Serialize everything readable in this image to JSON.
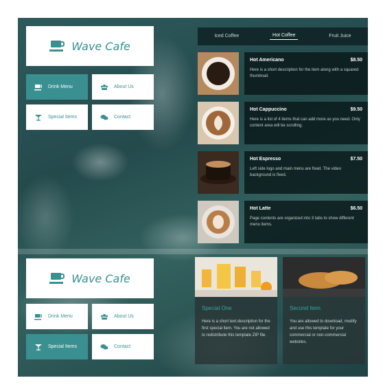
{
  "brand": {
    "name": "Wave Cafe",
    "accent": "#3a9090"
  },
  "nav_top": {
    "items": [
      {
        "label": "Drink Menu",
        "icon": "coffee-icon",
        "active": true
      },
      {
        "label": "About Us",
        "icon": "users-icon",
        "active": false
      },
      {
        "label": "Special Items",
        "icon": "cocktail-icon",
        "active": false
      },
      {
        "label": "Contact",
        "icon": "chat-icon",
        "active": false
      }
    ]
  },
  "nav_bottom": {
    "items": [
      {
        "label": "Drink Menu",
        "icon": "coffee-icon",
        "active": false
      },
      {
        "label": "About Us",
        "icon": "users-icon",
        "active": false
      },
      {
        "label": "Special Items",
        "icon": "cocktail-icon",
        "active": true
      },
      {
        "label": "Contact",
        "icon": "chat-icon",
        "active": false
      }
    ]
  },
  "tabs": [
    {
      "label": "Iced Coffee",
      "active": false
    },
    {
      "label": "Hot Coffee",
      "active": true
    },
    {
      "label": "Fruit Juice",
      "active": false
    }
  ],
  "menu_items": [
    {
      "name": "Hot Americano",
      "price": "$8.50",
      "desc": "Here is a short description for the item along with a squared thumbnail."
    },
    {
      "name": "Hot Cappuccino",
      "price": "$9.50",
      "desc": "Here is a list of 4 items that can add more as you need. Only content area will be scrolling."
    },
    {
      "name": "Hot Espresso",
      "price": "$7.50",
      "desc": "Left side logo and main menu are fixed. The video background is fixed."
    },
    {
      "name": "Hot Latte",
      "price": "$6.50",
      "desc": "Page contents are organized into 3 tabs to show different menu items."
    }
  ],
  "specials": [
    {
      "title": "Special One",
      "desc": "Here is a short text description for the first special item. You are not allowed to redistribute this template ZIP file."
    },
    {
      "title": "Second Item",
      "desc": "You are allowed to download, modify and use this template for your commercial or non-commercial websites."
    }
  ]
}
